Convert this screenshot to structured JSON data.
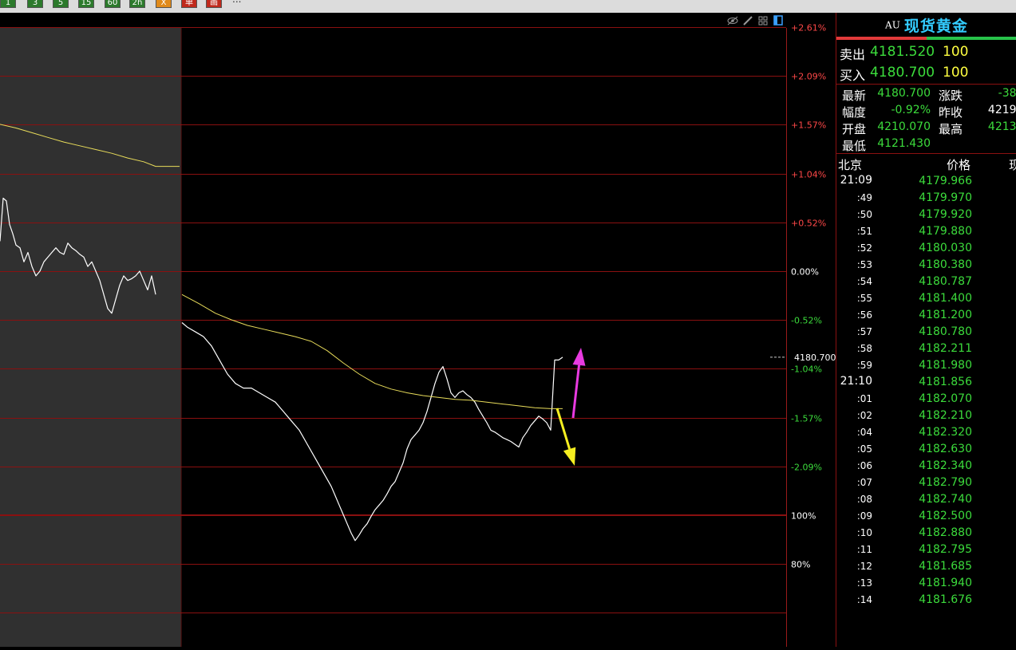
{
  "toolbar": {
    "buttons": [
      {
        "label": "1",
        "color": "green"
      },
      {
        "label": "3",
        "color": "green"
      },
      {
        "label": "5",
        "color": "green"
      },
      {
        "label": "15",
        "color": "green"
      },
      {
        "label": "60",
        "color": "green"
      },
      {
        "label": "2h",
        "color": "green"
      },
      {
        "label": "X",
        "color": "orange"
      },
      {
        "label": "单",
        "color": "red"
      },
      {
        "label": "画",
        "color": "red"
      }
    ],
    "more_label": "..."
  },
  "chart_tools": [
    "eye-icon",
    "pencil-icon",
    "layout-icon",
    "window-icon"
  ],
  "chart_data": {
    "type": "line",
    "instrument": "AU 现货黄金",
    "prev_close_pct": 0.0,
    "right_axis_ticks": [
      "+2.61%",
      "+2.09%",
      "+1.57%",
      "+1.04%",
      "+0.52%",
      "0.00%",
      "-0.52%",
      "-1.04%",
      "-1.57%",
      "-2.09%"
    ],
    "volume_axis_ticks": [
      "100%",
      "80%"
    ],
    "last_price_label": "4180.700",
    "series": [
      {
        "role": "price",
        "color": "#ffffff",
        "x": [
          0,
          4,
          8,
          12,
          16,
          20,
          25,
          30,
          35,
          40,
          45,
          50,
          55,
          60,
          65,
          70,
          75,
          80,
          85,
          90,
          95,
          100,
          105,
          110,
          115,
          120,
          125,
          130,
          135,
          140,
          145,
          150,
          155,
          160,
          165,
          170,
          175,
          180,
          185,
          190,
          195
        ],
        "y": [
          0.32,
          0.78,
          0.75,
          0.5,
          0.4,
          0.28,
          0.25,
          0.1,
          0.2,
          0.05,
          -0.05,
          0.0,
          0.1,
          0.15,
          0.2,
          0.25,
          0.2,
          0.18,
          0.3,
          0.25,
          0.22,
          0.18,
          0.15,
          0.05,
          0.1,
          0.0,
          -0.1,
          -0.25,
          -0.4,
          -0.45,
          -0.3,
          -0.15,
          -0.05,
          -0.1,
          -0.08,
          -0.05,
          0.0,
          -0.1,
          -0.2,
          -0.05,
          -0.25
        ]
      },
      {
        "role": "price",
        "color": "#ffffff",
        "x": [
          228,
          235,
          245,
          255,
          265,
          275,
          285,
          295,
          305,
          315,
          325,
          335,
          345,
          355,
          365,
          375,
          385,
          395,
          405,
          415,
          420,
          425,
          430,
          435,
          440,
          445,
          450,
          455,
          460,
          465,
          470,
          475,
          480,
          485,
          490,
          495,
          500,
          505,
          510,
          515,
          520,
          525,
          530,
          535,
          540,
          545,
          550,
          555,
          560,
          565,
          570,
          575,
          580,
          585,
          590,
          595,
          600,
          605,
          610,
          615,
          620,
          625,
          630,
          635,
          640,
          645,
          650,
          655,
          660,
          665,
          670,
          675,
          680,
          685,
          690,
          695,
          700,
          705
        ],
        "y": [
          -0.55,
          -0.6,
          -0.65,
          -0.7,
          -0.8,
          -0.95,
          -1.1,
          -1.2,
          -1.25,
          -1.25,
          -1.3,
          -1.35,
          -1.4,
          -1.5,
          -1.6,
          -1.7,
          -1.85,
          -2.0,
          -2.15,
          -2.3,
          -2.4,
          -2.5,
          -2.6,
          -2.7,
          -2.8,
          -2.88,
          -2.82,
          -2.75,
          -2.7,
          -2.62,
          -2.55,
          -2.5,
          -2.45,
          -2.38,
          -2.3,
          -2.25,
          -2.15,
          -2.05,
          -1.9,
          -1.8,
          -1.75,
          -1.7,
          -1.62,
          -1.5,
          -1.35,
          -1.2,
          -1.08,
          -1.02,
          -1.15,
          -1.3,
          -1.35,
          -1.3,
          -1.28,
          -1.32,
          -1.35,
          -1.4,
          -1.48,
          -1.55,
          -1.62,
          -1.7,
          -1.72,
          -1.75,
          -1.78,
          -1.8,
          -1.82,
          -1.85,
          -1.88,
          -1.78,
          -1.72,
          -1.65,
          -1.6,
          -1.55,
          -1.58,
          -1.62,
          -1.7,
          -0.95,
          -0.95,
          -0.92
        ]
      },
      {
        "role": "average",
        "color": "#e8dc5a",
        "x": [
          0,
          20,
          40,
          60,
          80,
          100,
          120,
          140,
          160,
          180,
          195,
          225
        ],
        "y": [
          1.57,
          1.53,
          1.48,
          1.43,
          1.38,
          1.34,
          1.3,
          1.26,
          1.21,
          1.17,
          1.12,
          1.12
        ]
      },
      {
        "role": "average",
        "color": "#e8dc5a",
        "x": [
          228,
          250,
          270,
          290,
          310,
          330,
          350,
          370,
          390,
          410,
          430,
          450,
          470,
          490,
          510,
          530,
          550,
          570,
          590,
          610,
          630,
          650,
          670,
          690,
          705
        ],
        "y": [
          -0.25,
          -0.35,
          -0.45,
          -0.52,
          -0.58,
          -0.62,
          -0.66,
          -0.7,
          -0.75,
          -0.85,
          -0.98,
          -1.1,
          -1.2,
          -1.26,
          -1.3,
          -1.33,
          -1.35,
          -1.37,
          -1.38,
          -1.4,
          -1.42,
          -1.44,
          -1.46,
          -1.47,
          -1.47
        ]
      }
    ],
    "arrows": [
      {
        "color": "#e83ae0",
        "direction": "up"
      },
      {
        "color": "#f5ee20",
        "direction": "down"
      }
    ]
  },
  "quote": {
    "code": "AU",
    "name": "现货黄金",
    "sell": {
      "label": "卖出",
      "price": "4181.520",
      "vol": "100"
    },
    "buy": {
      "label": "买入",
      "price": "4180.700",
      "vol": "100"
    },
    "stats": [
      {
        "label": "最新",
        "value": "4180.700",
        "color": "#3cdc3c",
        "label2": "涨跌",
        "value2": "-38.",
        "color2": "#3cdc3c"
      },
      {
        "label": "幅度",
        "value": "-0.92%",
        "color": "#3cdc3c",
        "label2": "昨收",
        "value2": "4219.",
        "color2": "#ffffff"
      },
      {
        "label": "开盘",
        "value": "4210.070",
        "color": "#3cdc3c",
        "label2": "最高",
        "value2": "4213.",
        "color2": "#3cdc3c"
      },
      {
        "label": "最低",
        "value": "4121.430",
        "color": "#3cdc3c",
        "label2": "",
        "value2": "",
        "color2": "#ffffff"
      }
    ],
    "ticks_header": {
      "time": "北京",
      "price": "价格",
      "vol": "现"
    },
    "ticks": [
      {
        "t": "21:09",
        "p": "4179.966",
        "big": true
      },
      {
        "t": ":49",
        "p": "4179.970"
      },
      {
        "t": ":50",
        "p": "4179.920"
      },
      {
        "t": ":51",
        "p": "4179.880"
      },
      {
        "t": ":52",
        "p": "4180.030"
      },
      {
        "t": ":53",
        "p": "4180.380"
      },
      {
        "t": ":54",
        "p": "4180.787"
      },
      {
        "t": ":55",
        "p": "4181.400"
      },
      {
        "t": ":56",
        "p": "4181.200"
      },
      {
        "t": ":57",
        "p": "4180.780"
      },
      {
        "t": ":58",
        "p": "4182.211"
      },
      {
        "t": ":59",
        "p": "4181.980"
      },
      {
        "t": "21:10",
        "p": "4181.856",
        "big": true
      },
      {
        "t": ":01",
        "p": "4182.070"
      },
      {
        "t": ":02",
        "p": "4182.210"
      },
      {
        "t": ":04",
        "p": "4182.320"
      },
      {
        "t": ":05",
        "p": "4182.630"
      },
      {
        "t": ":06",
        "p": "4182.340"
      },
      {
        "t": ":07",
        "p": "4182.790"
      },
      {
        "t": ":08",
        "p": "4182.740"
      },
      {
        "t": ":09",
        "p": "4182.500"
      },
      {
        "t": ":10",
        "p": "4182.880"
      },
      {
        "t": ":11",
        "p": "4182.795"
      },
      {
        "t": ":12",
        "p": "4181.685"
      },
      {
        "t": ":13",
        "p": "4181.940"
      },
      {
        "t": ":14",
        "p": "4181.676"
      }
    ]
  }
}
